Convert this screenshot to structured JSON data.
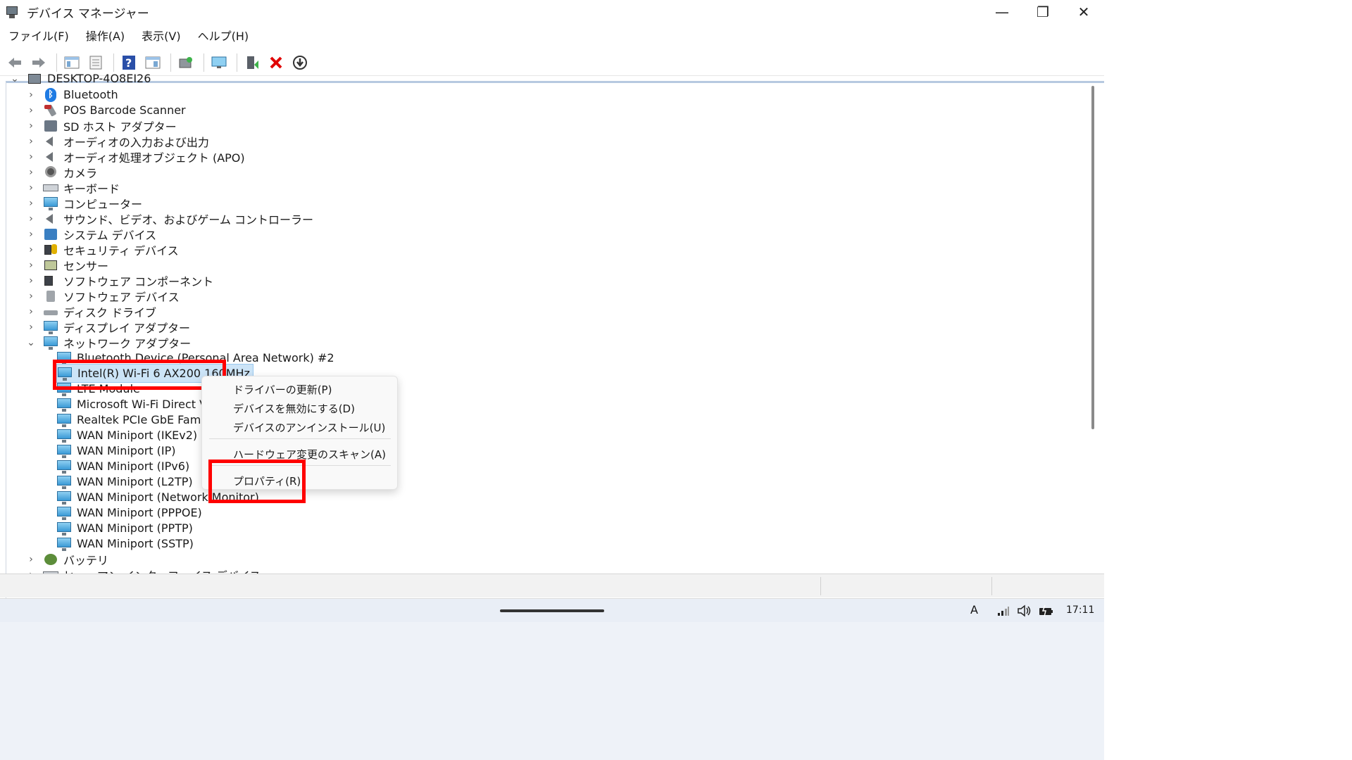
{
  "window": {
    "title": "デバイス マネージャー",
    "minimize": "—",
    "maximize": "❐",
    "close": "✕"
  },
  "menu": [
    "ファイル(F)",
    "操作(A)",
    "表示(V)",
    "ヘルプ(H)"
  ],
  "tree": {
    "root": "DESKTOP-4O8EI26",
    "categories": [
      {
        "label": "Bluetooth",
        "icon": "bluetooth-icon"
      },
      {
        "label": "POS Barcode Scanner",
        "icon": "barcode-scanner-icon"
      },
      {
        "label": "SD ホスト アダプター",
        "icon": "sd-host-icon"
      },
      {
        "label": "オーディオの入力および出力",
        "icon": "speaker-icon"
      },
      {
        "label": "オーディオ処理オブジェクト (APO)",
        "icon": "speaker-icon"
      },
      {
        "label": "カメラ",
        "icon": "camera-icon"
      },
      {
        "label": "キーボード",
        "icon": "keyboard-icon"
      },
      {
        "label": "コンピューター",
        "icon": "computer-icon"
      },
      {
        "label": "サウンド、ビデオ、およびゲーム コントローラー",
        "icon": "speaker-icon"
      },
      {
        "label": "システム デバイス",
        "icon": "system-folder-icon"
      },
      {
        "label": "セキュリティ デバイス",
        "icon": "security-key-icon"
      },
      {
        "label": "センサー",
        "icon": "sensor-icon"
      },
      {
        "label": "ソフトウェア コンポーネント",
        "icon": "software-component-icon"
      },
      {
        "label": "ソフトウェア デバイス",
        "icon": "software-device-icon"
      },
      {
        "label": "ディスク ドライブ",
        "icon": "disk-drive-icon"
      },
      {
        "label": "ディスプレイ アダプター",
        "icon": "display-adapter-icon"
      }
    ],
    "network": {
      "label": "ネットワーク アダプター",
      "children": [
        "Bluetooth Device (Personal Area Network) #2",
        "Intel(R) Wi-Fi 6 AX200 160MHz",
        "LTE Module",
        "Microsoft Wi-Fi Direct Virtua",
        "Realtek PCIe GbE Family Cor",
        "WAN Miniport (IKEv2)",
        "WAN Miniport (IP)",
        "WAN Miniport (IPv6)",
        "WAN Miniport (L2TP)",
        "WAN Miniport (Network Monitor)",
        "WAN Miniport (PPPOE)",
        "WAN Miniport (PPTP)",
        "WAN Miniport (SSTP)"
      ]
    },
    "after": [
      {
        "label": "バッテリ",
        "icon": "battery-icon"
      },
      {
        "label": "ヒューマン インターフェイス デバイス",
        "icon": "hid-icon"
      }
    ]
  },
  "context_menu": {
    "update_driver": "ドライバーの更新(P)",
    "disable": "デバイスを無効にする(D)",
    "uninstall": "デバイスのアンインストール(U)",
    "scan": "ハードウェア変更のスキャン(A)",
    "properties": "プロパティ(R)"
  },
  "taskbar": {
    "ime": "A",
    "time": "17:11"
  },
  "colors": {
    "highlight": "#ff0000",
    "selection": "#cce4f7"
  }
}
